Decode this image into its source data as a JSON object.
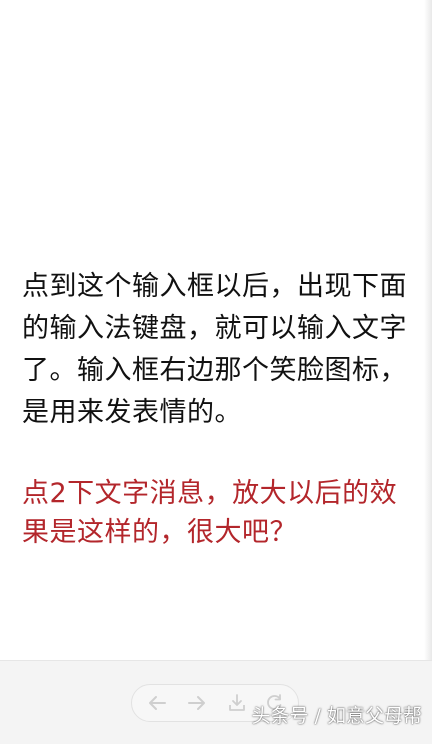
{
  "content": {
    "body_text": "点到这个输入框以后，出现下面的输入法键盘，就可以输入文字了。输入框右边那个笑脸图标，是用来发表情的。",
    "highlight_text": "点2下文字消息，放大以后的效果是这样的，很大吧？"
  },
  "toolbar": {
    "back_icon": "arrow-left-icon",
    "forward_icon": "arrow-right-icon",
    "download_icon": "download-icon",
    "refresh_icon": "refresh-icon"
  },
  "watermark": {
    "text": "头条号 / 如意父母帮"
  },
  "colors": {
    "body_text": "#111111",
    "highlight_text": "#b3262b",
    "bottom_bar": "#f4f4f4",
    "icon": "#d0d0d0"
  }
}
